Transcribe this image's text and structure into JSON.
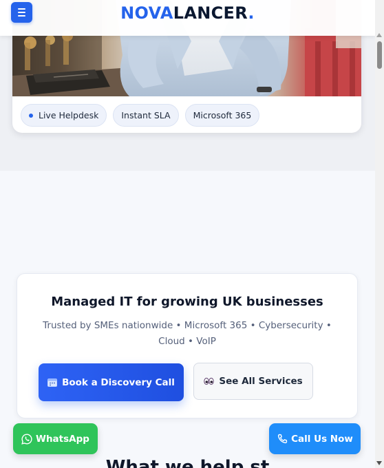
{
  "header": {
    "logo_part1": "NOVA",
    "logo_part2": "LANCER",
    "logo_dot": ".",
    "menu_icon": "hamburger-menu-icon",
    "accent_color": "#2563eb"
  },
  "hero": {
    "tags": [
      {
        "label": "Live Helpdesk",
        "dot": true
      },
      {
        "label": "Instant SLA"
      },
      {
        "label": "Microsoft 365"
      }
    ]
  },
  "cta": {
    "title": "Managed IT for growing UK businesses",
    "subtitle": "Trusted by SMEs nationwide • Microsoft 365 • Cybersecurity • Cloud • VoIP",
    "primary_button": {
      "label": "Book a Discovery Call",
      "icon": "calendar-icon"
    },
    "secondary_button": {
      "label": "See All Services",
      "icon": "eyes-icon"
    }
  },
  "floating": {
    "whatsapp": {
      "label": "WhatsApp",
      "icon": "whatsapp-icon",
      "color": "#2fc45a"
    },
    "call": {
      "label": "Call Us Now",
      "icon": "phone-icon",
      "color": "#1f8dfa"
    }
  },
  "next_section": {
    "heading_partial": "What we help st"
  }
}
